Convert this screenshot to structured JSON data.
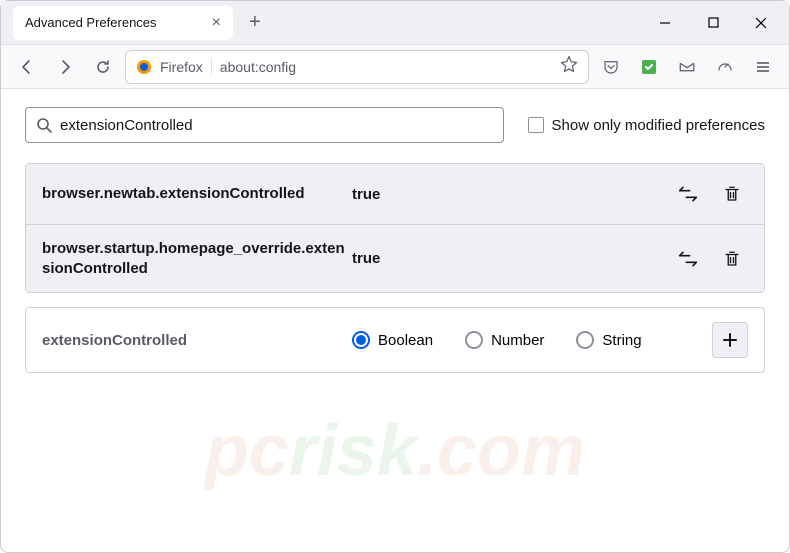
{
  "window": {
    "tab_title": "Advanced Preferences"
  },
  "toolbar": {
    "brand": "Firefox",
    "url": "about:config"
  },
  "search": {
    "value": "extensionControlled",
    "checkbox_label": "Show only modified preferences"
  },
  "prefs": [
    {
      "name": "browser.newtab.extensionControlled",
      "value": "true"
    },
    {
      "name": "browser.startup.homepage_override.extensionControlled",
      "value": "true"
    }
  ],
  "newpref": {
    "name": "extensionControlled",
    "types": [
      "Boolean",
      "Number",
      "String"
    ],
    "selected": "Boolean"
  },
  "watermark": {
    "a": "pc",
    "b": "risk",
    "c": ".com"
  }
}
